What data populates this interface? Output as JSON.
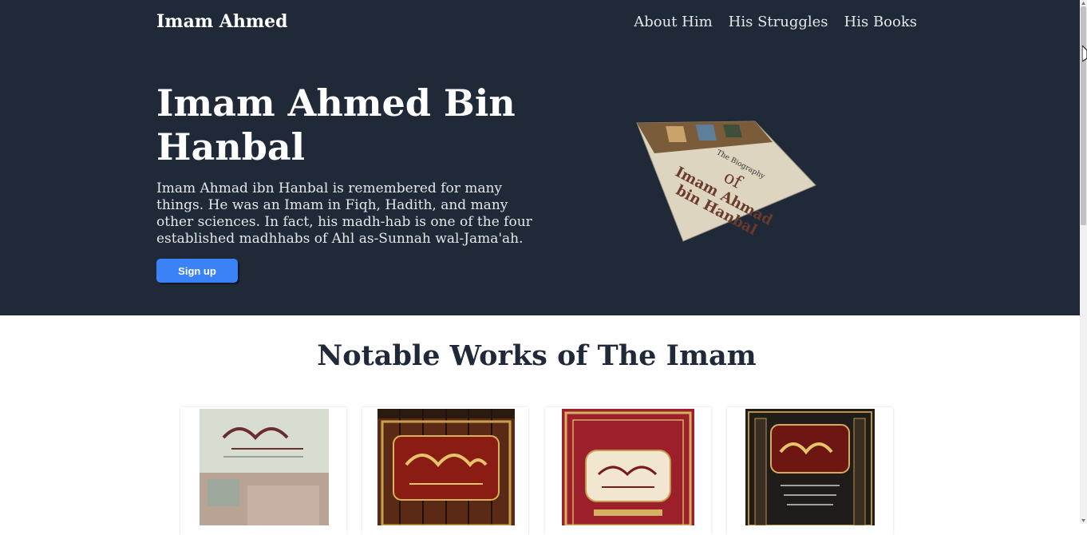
{
  "nav": {
    "brand": "Imam Ahmed",
    "links": [
      "About Him",
      "His Struggles",
      "His Books"
    ]
  },
  "hero": {
    "title": "Imam Ahmed Bin Hanbal",
    "description": "Imam Ahmad ibn Hanbal is remembered for many things. He was an Imam in Fiqh, Hadith, and many other sciences. In fact, his madh-hab is one of the four established madhhabs of Ahl as-Sunnah wal-Jama'ah.",
    "signup_label": "Sign up",
    "book_cover": {
      "line1": "The Biography",
      "line2": "of",
      "line3": "Imam Ahmad",
      "line4": "bin Hanbal"
    }
  },
  "works": {
    "title": "Notable Works of The Imam"
  },
  "colors": {
    "hero_bg": "#1f2937",
    "accent": "#3b82f6",
    "heading": "#1f2937"
  }
}
